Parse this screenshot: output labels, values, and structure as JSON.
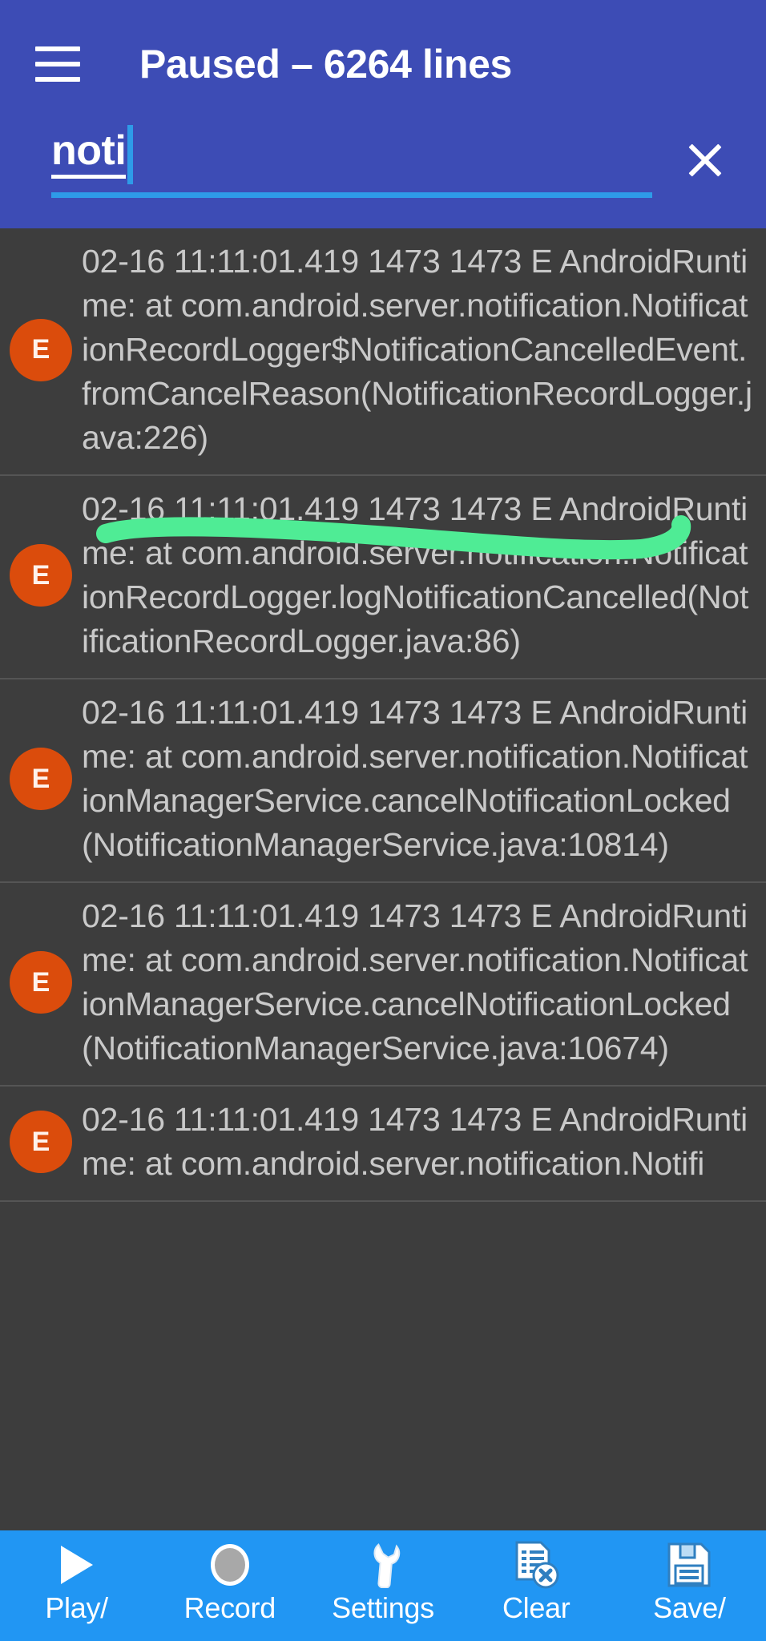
{
  "header": {
    "menu_icon": "hamburger-menu-icon",
    "title": "Paused – 6264 lines",
    "bg_color": "#3D4CB5"
  },
  "search": {
    "value": "noti",
    "placeholder": "Search",
    "clear_icon": "close-x-icon",
    "caret_color": "#2E9BE8",
    "underline_color": "#2E9BE8"
  },
  "log": {
    "badge_color": "#DB4C0C",
    "text_color": "#C9C9C9",
    "bg_color": "#3D3D3D",
    "entries": [
      {
        "level": "E",
        "text": "02-16 11:11:01.419  1473  1473 E AndroidRuntime:  at com.android.server.notification.NotificationRecordLogger$NotificationCancelledEvent.fromCancelReason(NotificationRecordLogger.java:226)"
      },
      {
        "level": "E",
        "text": "02-16 11:11:01.419  1473  1473 E AndroidRuntime:  at com.android.server.notification.NotificationRecordLogger.logNotificationCancelled(NotificationRecordLogger.java:86)"
      },
      {
        "level": "E",
        "text": "02-16 11:11:01.419  1473  1473 E AndroidRuntime:  at com.android.server.notification.NotificationManagerService.cancelNotificationLocked(NotificationManagerService.java:10814)"
      },
      {
        "level": "E",
        "text": "02-16 11:11:01.419  1473  1473 E AndroidRuntime:  at com.android.server.notification.NotificationManagerService.cancelNotificationLocked(NotificationManagerService.java:10674)"
      },
      {
        "level": "E",
        "text": "02-16 11:11:01.419  1473  1473 E AndroidRuntime:  at com.android.server.notification.Notifi"
      }
    ]
  },
  "annotation": {
    "type": "freehand-highlight-stroke",
    "color": "#4FEC95",
    "stroke_width": 22
  },
  "toolbar": {
    "bg_color": "#2196F3",
    "items": [
      {
        "label": "Play/",
        "icon": "play-triangle-icon"
      },
      {
        "label": "Record",
        "icon": "record-circle-icon"
      },
      {
        "label": "Settings",
        "icon": "wrench-icon"
      },
      {
        "label": "Clear",
        "icon": "document-delete-icon"
      },
      {
        "label": "Save/",
        "icon": "floppy-disk-save-icon"
      }
    ]
  }
}
